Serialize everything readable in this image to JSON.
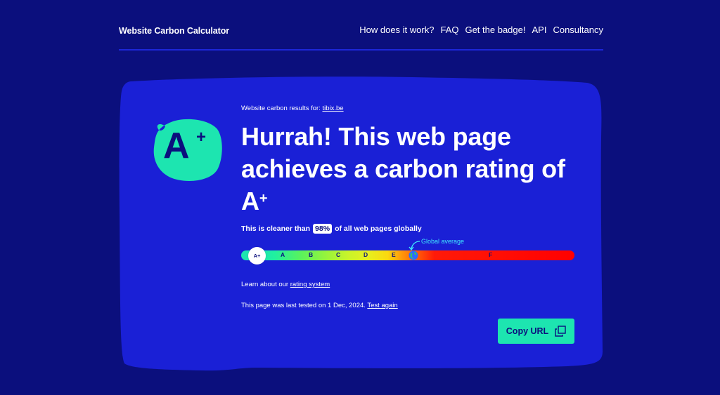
{
  "header": {
    "brand": "Website Carbon Calculator",
    "nav": [
      {
        "label": "How does it work?"
      },
      {
        "label": "FAQ"
      },
      {
        "label": "Get the badge!"
      },
      {
        "label": "API"
      },
      {
        "label": "Consultancy"
      }
    ]
  },
  "result": {
    "results_prefix": "Website carbon results for:",
    "site": "tibix.be",
    "badge_letter": "A",
    "badge_plus": "+",
    "headline": "Hurrah! This web page achieves a carbon rating of A",
    "headline_plus": "+",
    "cleaner_prefix": "This is cleaner than",
    "cleaner_pct": "98%",
    "cleaner_suffix": "of all web pages globally",
    "learn_prefix": "Learn about our",
    "learn_link": "rating system",
    "tested_prefix": "This page was last tested on 1 Dec, 2024.",
    "test_again": "Test again",
    "copy_label": "Copy URL"
  },
  "rating_bar": {
    "current": "A+",
    "labels": [
      "A",
      "B",
      "C",
      "D",
      "E",
      "F"
    ],
    "global_average_label": "Global average"
  },
  "colors": {
    "background": "#0b0f7d",
    "card": "#1a20d6",
    "accent": "#1de5b0",
    "annotation": "#3fe7ff"
  },
  "icons": {
    "copy": "copy-icon",
    "globe": "globe-icon",
    "arrow": "curved-arrow-icon"
  }
}
